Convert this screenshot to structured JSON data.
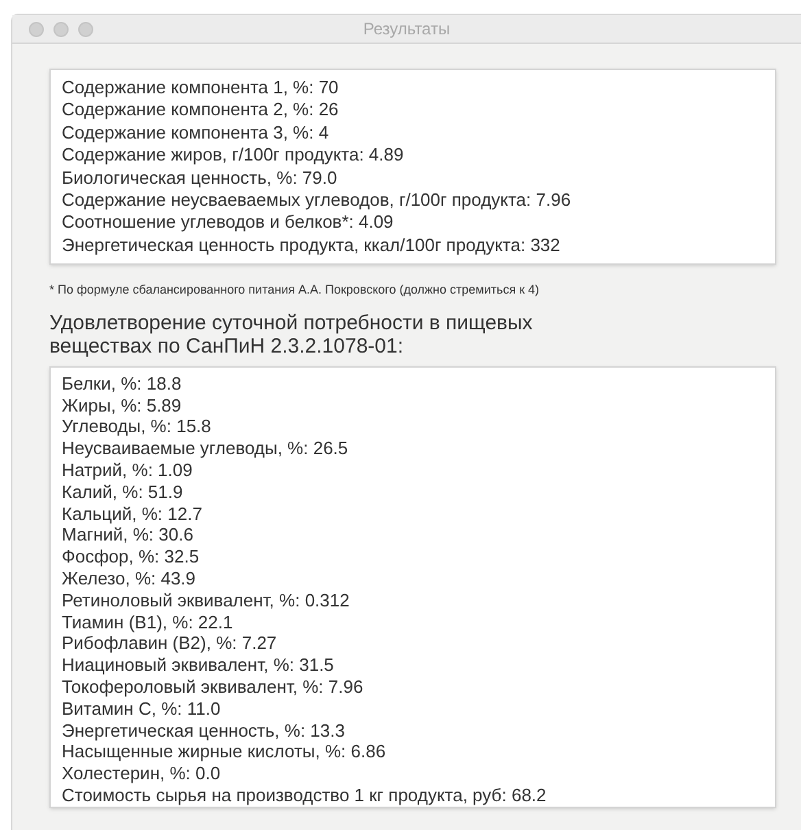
{
  "window": {
    "title": "Результаты"
  },
  "summary": [
    "Содержание компонента 1, %: 70",
    "Содержание компонента 2, %: 26",
    "Содержание компонента 3, %: 4",
    "Содержание жиров, г/100г продукта: 4.89",
    "Биологическая ценность, %: 79.0",
    "Содержание неусваеваемых углеводов, г/100г продукта: 7.96",
    "Соотношение углеводов и белков*: 4.09",
    "Энергетическая ценность продукта, ккал/100г продукта: 332"
  ],
  "footnote": "* По формуле сбалансированного питания А.А. Покровского (должно стремиться к 4)",
  "heading": "Удовлетворение суточной потребности в пищевых веществах по СанПиН 2.3.2.1078-01:",
  "needs": [
    "Белки, %: 18.8",
    "Жиры, %: 5.89",
    "Углеводы, %: 15.8",
    "Неусваиваемые углеводы, %: 26.5",
    "Натрий, %: 1.09",
    "Калий, %: 51.9",
    "Кальций, %: 12.7",
    "Магний, %: 30.6",
    "Фосфор, %: 32.5",
    "Железо, %: 43.9",
    "Ретиноловый эквивалент, %: 0.312",
    "Тиамин (В1), %: 22.1",
    "Рибофлавин (В2), %: 7.27",
    "Ниациновый эквивалент, %: 31.5",
    "Токофероловый эквивалент, %: 7.96",
    "Витамин С, %: 11.0",
    "Энергетическая ценность, %: 13.3",
    "Насыщенные жирные кислоты, %: 6.86",
    "Холестерин, %: 0.0",
    "Стоимость сырья на производство 1 кг продукта, руб: 68.2"
  ]
}
